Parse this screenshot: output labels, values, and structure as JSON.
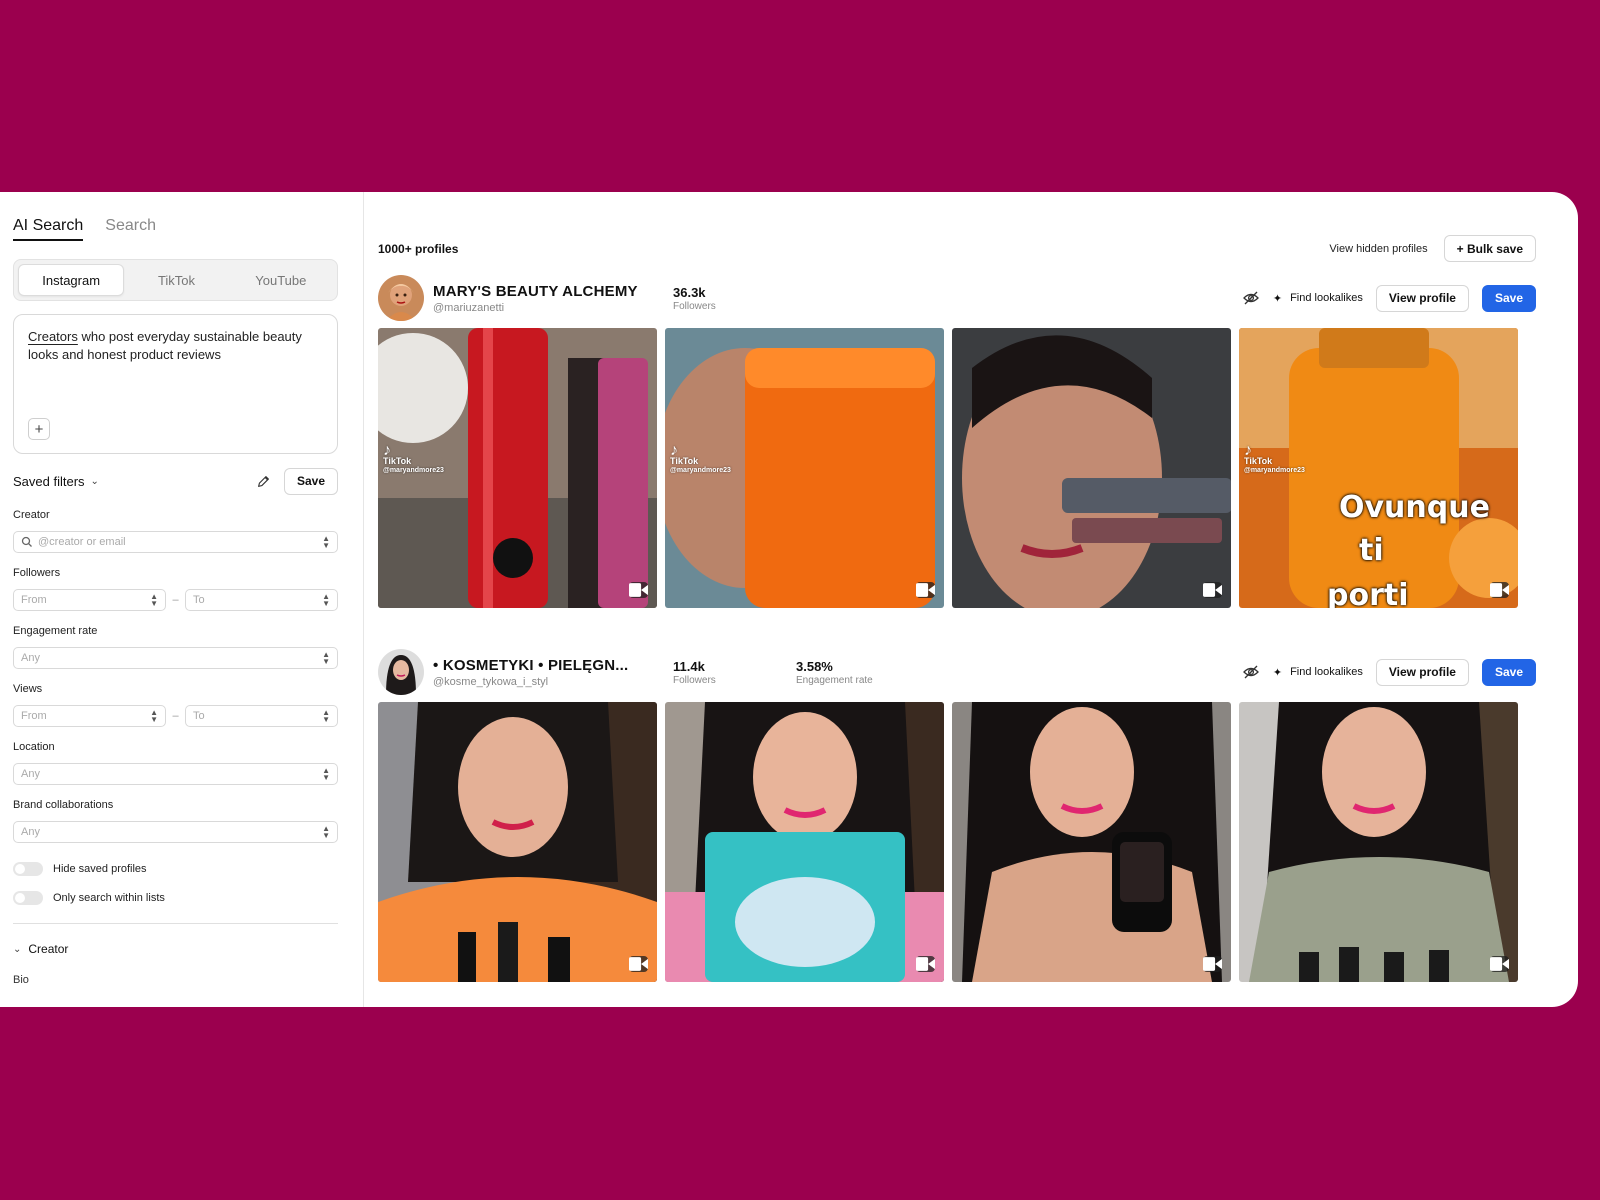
{
  "sidebar": {
    "mode_tabs": [
      "AI Search",
      "Search"
    ],
    "platforms": [
      "Instagram",
      "TikTok",
      "YouTube"
    ],
    "prompt": {
      "first_word": "Creators",
      "rest": " who post everyday sustainable beauty looks and honest product reviews"
    },
    "add_label": "+",
    "saved_filters": {
      "label": "Saved filters",
      "save_label": "Save"
    },
    "filters": {
      "creator": {
        "label": "Creator",
        "placeholder": "@creator or email"
      },
      "followers": {
        "label": "Followers",
        "from": "From",
        "to": "To"
      },
      "engagement": {
        "label": "Engagement rate",
        "value": "Any"
      },
      "views": {
        "label": "Views",
        "from": "From",
        "to": "To"
      },
      "location": {
        "label": "Location",
        "value": "Any"
      },
      "brand": {
        "label": "Brand collaborations",
        "value": "Any"
      }
    },
    "toggles": {
      "hide_saved": "Hide saved profiles",
      "only_lists": "Only search within lists"
    },
    "section": {
      "creator": "Creator",
      "bio": "Bio"
    }
  },
  "main": {
    "count": "1000+ profiles",
    "view_hidden": "View hidden profiles",
    "bulk_save": "+ Bulk save",
    "actions": {
      "find_lookalikes": "Find lookalikes",
      "view_profile": "View profile",
      "save": "Save"
    },
    "profiles": [
      {
        "name": "MARY'S BEAUTY ALCHEMY",
        "handle": "@mariuzanetti",
        "stats": [
          {
            "value": "36.3k",
            "label": "Followers"
          }
        ],
        "badge": {
          "platform": "TikTok",
          "handle": "@maryandmore23"
        },
        "overlay": {
          "line1": "Ovunque",
          "line2": "ti",
          "line3": "porti"
        }
      },
      {
        "name": "• KOSMETYKI • PIELĘGN...",
        "handle": "@kosme_tykowa_i_styl",
        "stats": [
          {
            "value": "11.4k",
            "label": "Followers"
          },
          {
            "value": "3.58%",
            "label": "Engagement rate"
          }
        ]
      }
    ]
  },
  "colors": {
    "background": "#9b004e",
    "primary": "#2265e6"
  }
}
